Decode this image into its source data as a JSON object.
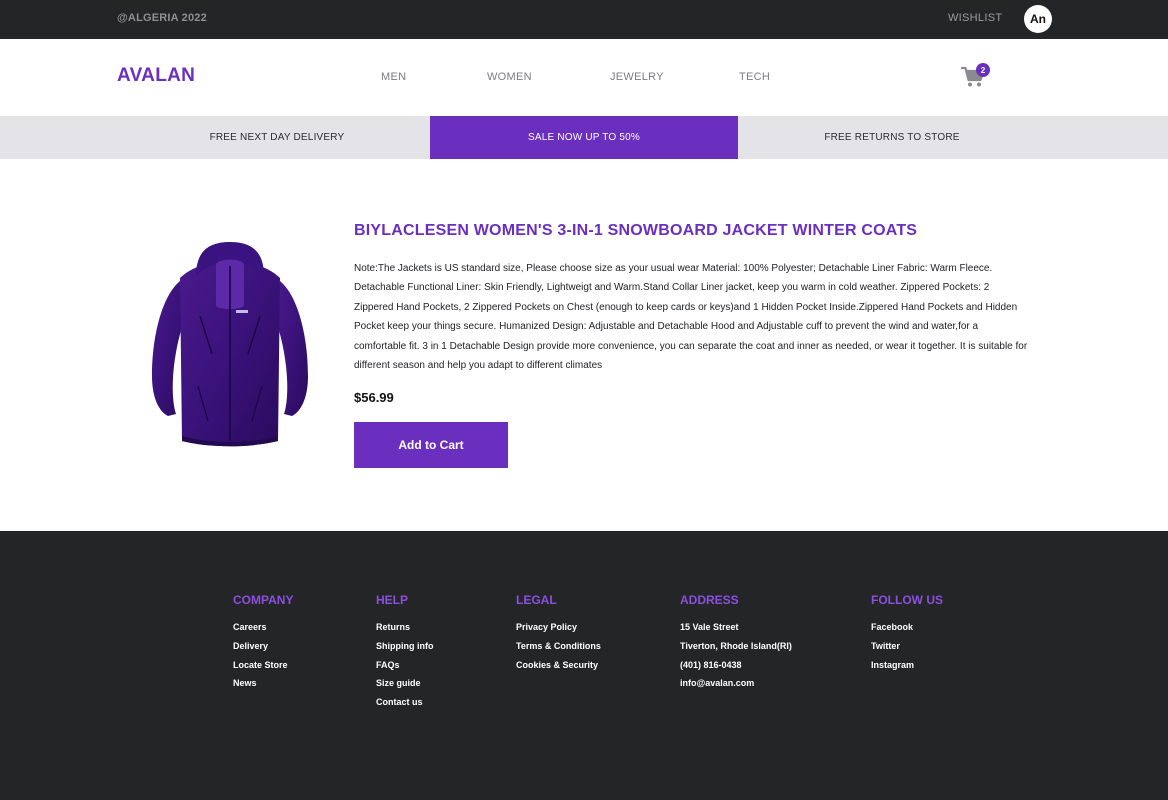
{
  "topbar": {
    "copyright": "@ALGERIA 2022",
    "wishlist": "WISHLIST",
    "avatar_initials": "An"
  },
  "nav": {
    "logo": "AVALAN",
    "links": [
      "MEN",
      "WOMEN",
      "JEWELRY",
      "TECH"
    ],
    "cart_count": "2",
    "cart_icon": "shopping-cart-icon"
  },
  "promo": {
    "items": [
      "FREE NEXT DAY DELIVERY",
      "SALE NOW UP TO 50%",
      "FREE RETURNS TO STORE"
    ]
  },
  "product": {
    "title": "BIYLACLESEN WOMEN'S 3-IN-1 SNOWBOARD JACKET WINTER COATS",
    "description": "Note:The Jackets is US standard size, Please choose size as your usual wear Material: 100% Polyester; Detachable Liner Fabric: Warm Fleece. Detachable Functional Liner: Skin Friendly, Lightweigt and Warm.Stand Collar Liner jacket, keep you warm in cold weather. Zippered Pockets: 2 Zippered Hand Pockets, 2 Zippered Pockets on Chest (enough to keep cards or keys)and 1 Hidden Pocket Inside.Zippered Hand Pockets and Hidden Pocket keep your things secure. Humanized Design: Adjustable and Detachable Hood and Adjustable cuff to prevent the wind and water,for a comfortable fit. 3 in 1 Detachable Design provide more convenience, you can separate the coat and inner as needed, or wear it together. It is suitable for different season and help you adapt to different climates",
    "price": "$56.99",
    "add_to_cart": "Add to Cart",
    "image_icon": "purple-jacket-image"
  },
  "footer": {
    "company": {
      "heading": "COMPANY",
      "items": [
        "Careers",
        "Delivery",
        "Locate Store",
        "News"
      ]
    },
    "help": {
      "heading": "HELP",
      "items": [
        "Returns",
        "Shipping info",
        "FAQs",
        "Size guide",
        "Contact us"
      ]
    },
    "legal": {
      "heading": "LEGAL",
      "items": [
        "Privacy Policy",
        "Terms & Conditions",
        "Cookies & Security"
      ]
    },
    "address": {
      "heading": "ADDRESS",
      "items": [
        "15 Vale Street",
        "Tiverton, Rhode Island(RI)",
        "(401) 816-0438",
        "info@avalan.com"
      ]
    },
    "follow": {
      "heading": "FOLLOW US",
      "items": [
        "Facebook",
        "Twitter",
        "Instagram"
      ]
    }
  },
  "colors": {
    "accent": "#6b2fbf",
    "dark": "#242527",
    "promo_bg": "#e4e4e8"
  }
}
